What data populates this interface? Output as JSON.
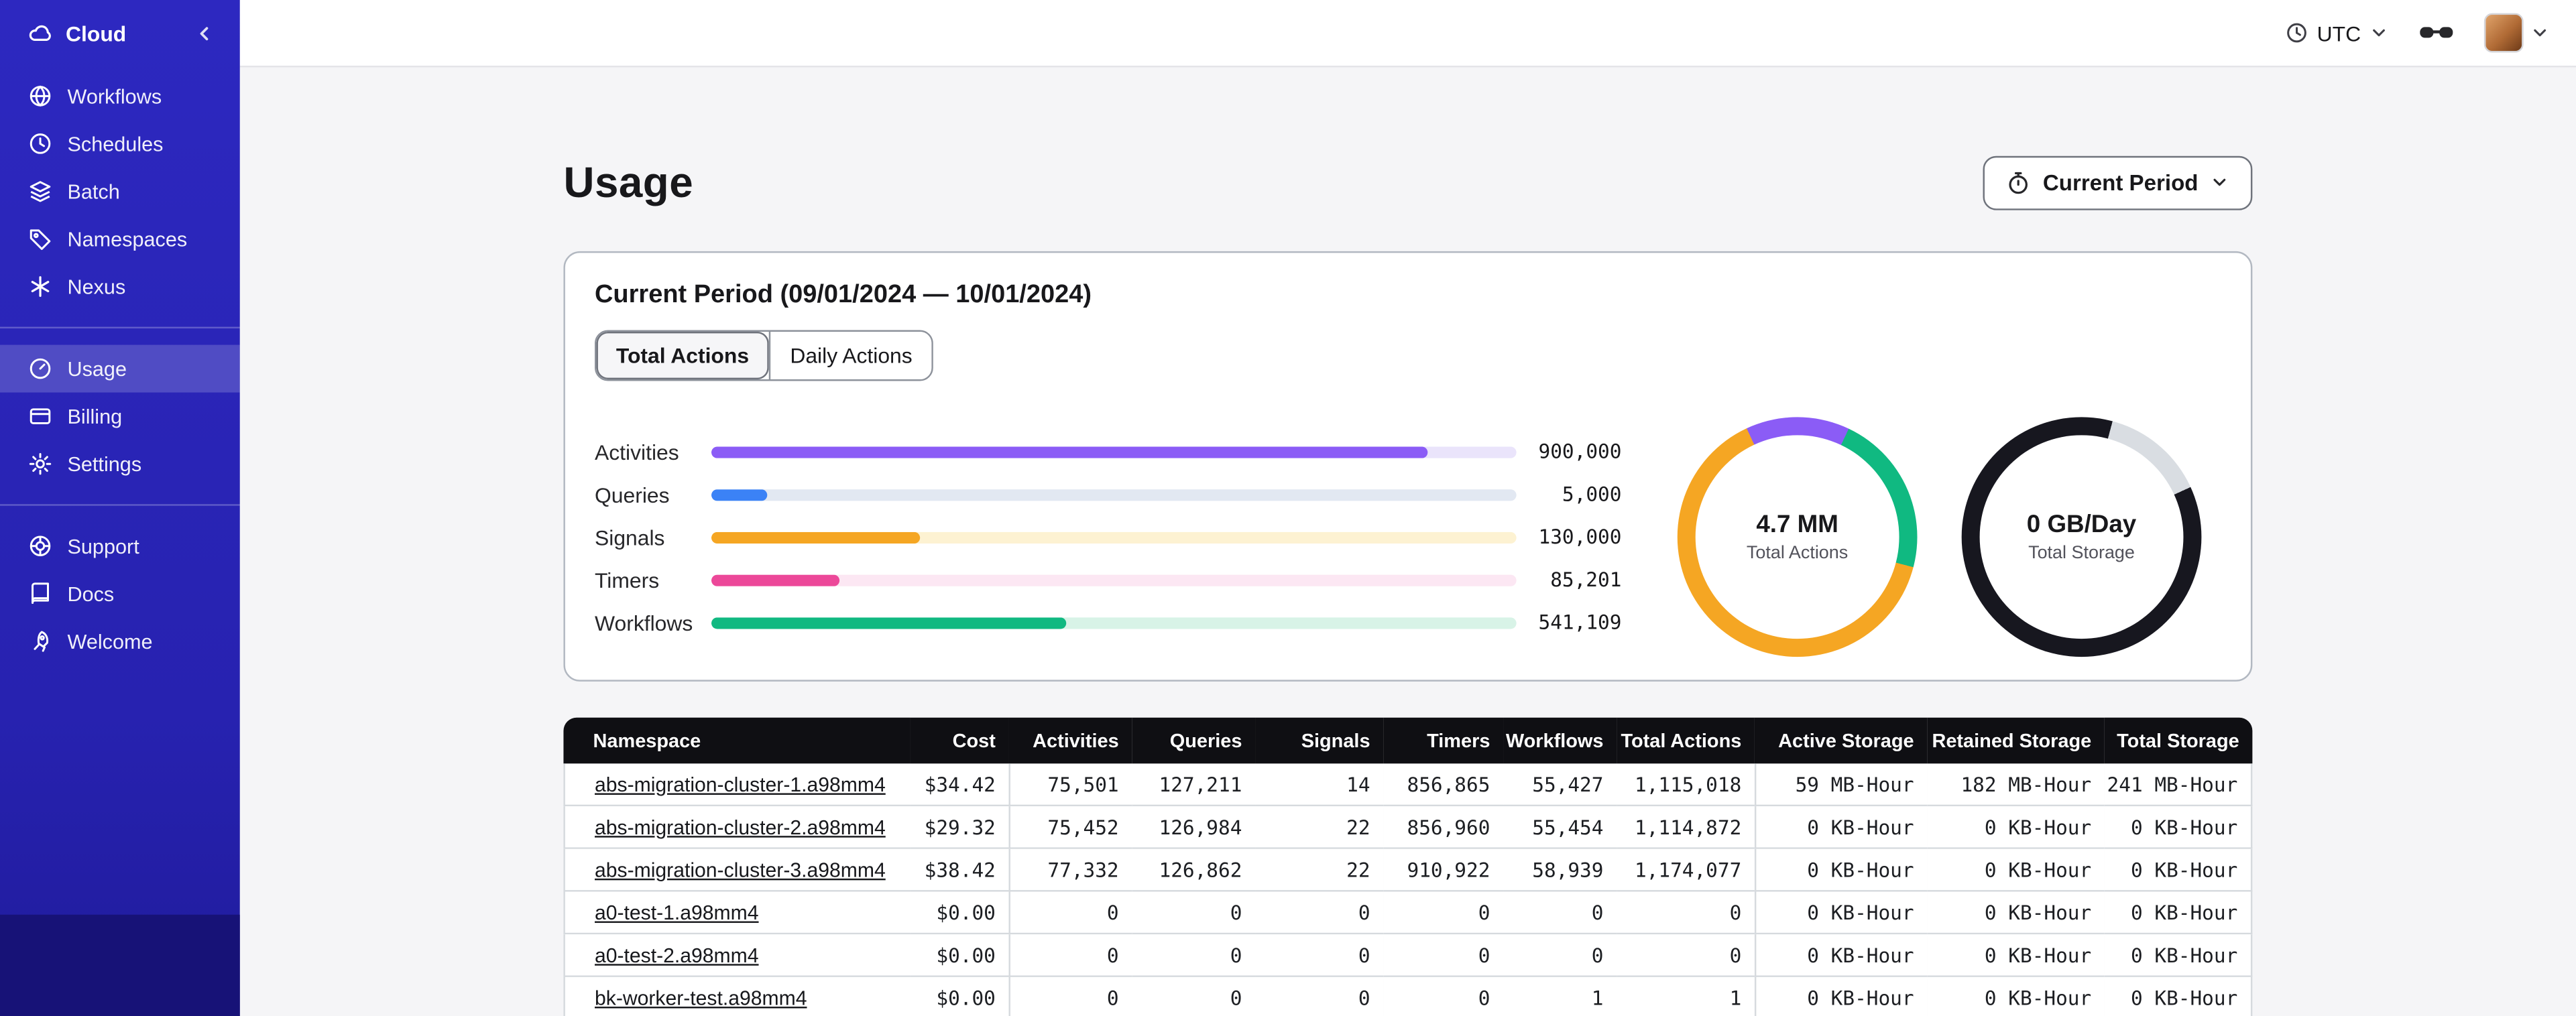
{
  "sidebar": {
    "brand": "Cloud",
    "sections": [
      {
        "items": [
          {
            "label": "Workflows"
          },
          {
            "label": "Schedules"
          },
          {
            "label": "Batch"
          },
          {
            "label": "Namespaces"
          },
          {
            "label": "Nexus"
          }
        ]
      },
      {
        "items": [
          {
            "label": "Usage",
            "active": true
          },
          {
            "label": "Billing"
          },
          {
            "label": "Settings"
          }
        ]
      },
      {
        "items": [
          {
            "label": "Support"
          },
          {
            "label": "Docs"
          },
          {
            "label": "Welcome"
          }
        ]
      }
    ]
  },
  "topbar": {
    "timezone": "UTC"
  },
  "page": {
    "title": "Usage",
    "period_button_label": "Current Period"
  },
  "usage_card": {
    "title": "Current Period (09/01/2024 — 10/01/2024)",
    "tabs": [
      {
        "label": "Total Actions",
        "active": true
      },
      {
        "label": "Daily Actions",
        "active": false
      }
    ],
    "chart_data": {
      "type": "bar",
      "orientation": "horizontal",
      "bars": [
        {
          "label": "Activities",
          "value_label": "900,000",
          "pct": 89,
          "color": "#8b5cf6",
          "track": "#eae4fb"
        },
        {
          "label": "Queries",
          "value_label": "5,000",
          "pct": 7,
          "color": "#3b82f6",
          "track": "#e2e8f2"
        },
        {
          "label": "Signals",
          "value_label": "130,000",
          "pct": 26,
          "color": "#f5a623",
          "track": "#fdf2d2"
        },
        {
          "label": "Timers",
          "value_label": "85,201",
          "pct": 16,
          "color": "#ec4899",
          "track": "#fce7f3"
        },
        {
          "label": "Workflows",
          "value_label": "541,109",
          "pct": 44,
          "color": "#10b981",
          "track": "#d8f3e7"
        }
      ]
    },
    "donuts": [
      {
        "value": "4.7 MM",
        "label": "Total Actions",
        "from_deg": -25,
        "segments": [
          {
            "color": "#8b5cf6",
            "pct": 14
          },
          {
            "color": "#10b981",
            "pct": 22
          },
          {
            "color": "#f5a623",
            "pct": 64
          }
        ]
      },
      {
        "value": "0 GB/Day",
        "label": "Total Storage",
        "from_deg": 15,
        "segments": [
          {
            "color": "#d9dde2",
            "pct": 14
          },
          {
            "color": "#17171f",
            "pct": 86
          }
        ]
      }
    ]
  },
  "table": {
    "columns": [
      "Namespace",
      "Cost",
      "Activities",
      "Queries",
      "Signals",
      "Timers",
      "Workflows",
      "Total Actions",
      "Active Storage",
      "Retained Storage",
      "Total Storage"
    ],
    "rows": [
      [
        "abs-migration-cluster-1.a98mm4",
        "$34.42",
        "75,501",
        "127,211",
        "14",
        "856,865",
        "55,427",
        "1,115,018",
        "59 MB-Hour",
        "182 MB-Hour",
        "241 MB-Hour"
      ],
      [
        "abs-migration-cluster-2.a98mm4",
        "$29.32",
        "75,452",
        "126,984",
        "22",
        "856,960",
        "55,454",
        "1,114,872",
        "0 KB-Hour",
        "0 KB-Hour",
        "0 KB-Hour"
      ],
      [
        "abs-migration-cluster-3.a98mm4",
        "$38.42",
        "77,332",
        "126,862",
        "22",
        "910,922",
        "58,939",
        "1,174,077",
        "0 KB-Hour",
        "0 KB-Hour",
        "0 KB-Hour"
      ],
      [
        "a0-test-1.a98mm4",
        "$0.00",
        "0",
        "0",
        "0",
        "0",
        "0",
        "0",
        "0 KB-Hour",
        "0 KB-Hour",
        "0 KB-Hour"
      ],
      [
        "a0-test-2.a98mm4",
        "$0.00",
        "0",
        "0",
        "0",
        "0",
        "0",
        "0",
        "0 KB-Hour",
        "0 KB-Hour",
        "0 KB-Hour"
      ],
      [
        "bk-worker-test.a98mm4",
        "$0.00",
        "0",
        "0",
        "0",
        "0",
        "1",
        "1",
        "0 KB-Hour",
        "0 KB-Hour",
        "0 KB-Hour"
      ]
    ]
  }
}
